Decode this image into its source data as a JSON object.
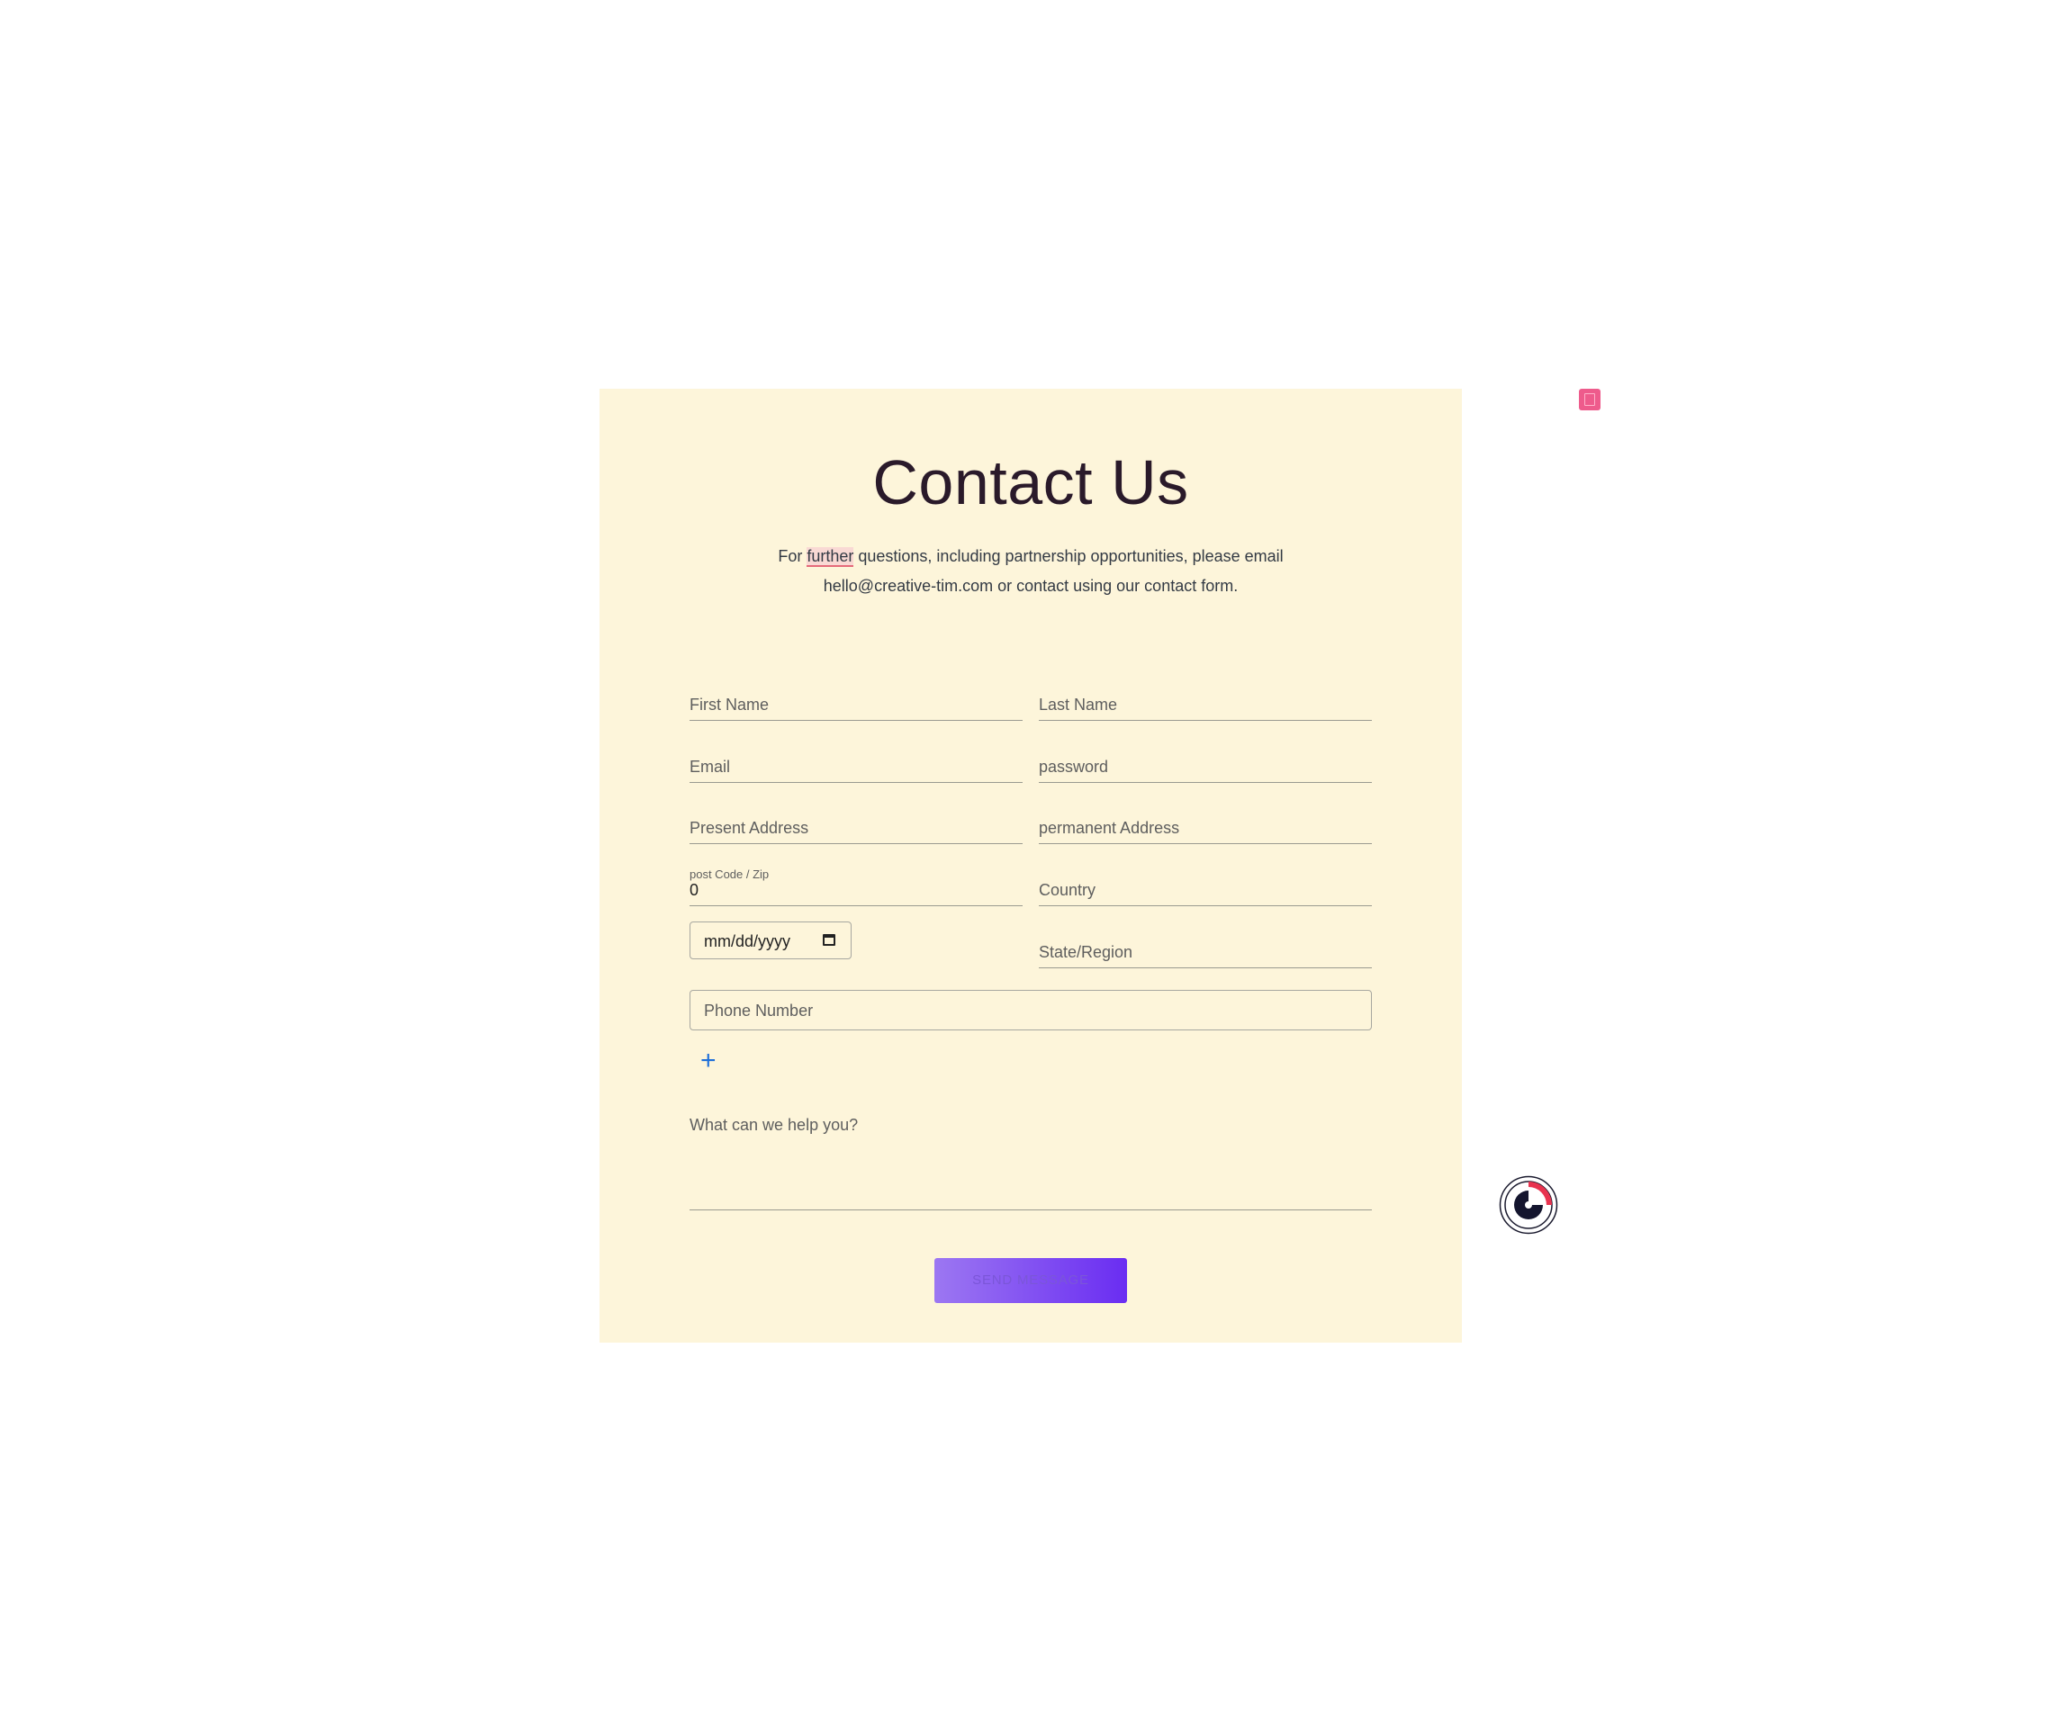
{
  "header": {
    "title": "Contact Us",
    "subtitle_before": "For ",
    "subtitle_highlight": "further",
    "subtitle_after": " questions, including partnership opportunities, please email hello@creative-tim.com or contact using our contact form."
  },
  "form": {
    "first_name_label": "First Name",
    "last_name_label": "Last Name",
    "email_label": "Email",
    "password_label": "password",
    "present_address_label": "Present Address",
    "permanent_address_label": "permanent Address",
    "post_code_label": "post Code / Zip",
    "post_code_value": "0",
    "country_label": "Country",
    "date_placeholder": "mm/dd/yyyy",
    "state_label": "State/Region",
    "phone_placeholder": "Phone Number",
    "add_symbol": "+",
    "message_label": "What can we help you?",
    "submit_label": "SEND MESSAGE"
  },
  "colors": {
    "card_background": "#fdf5da",
    "button_gradient_start": "#9c77f2",
    "button_gradient_end": "#6a2df2",
    "plus_accent": "#1e6fd9",
    "badge": "#ee5b8c"
  },
  "icons": {
    "calendar": "calendar-icon",
    "add": "plus-icon",
    "badge": "clipboard-icon",
    "floating": "eye-widget-icon"
  }
}
